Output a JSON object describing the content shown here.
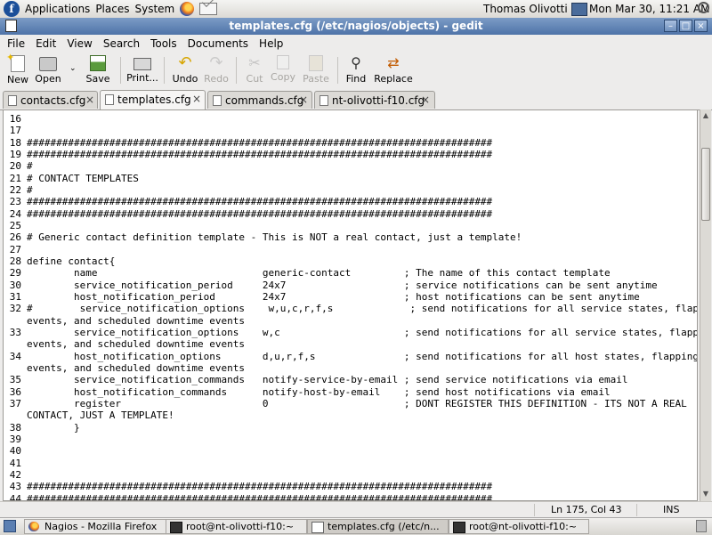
{
  "top_panel": {
    "logo_glyph": "f",
    "menus": [
      "Applications",
      "Places",
      "System"
    ],
    "user": "Thomas Olivotti",
    "clock": "Mon Mar 30, 11:21 AM"
  },
  "window": {
    "title": "templates.cfg (/etc/nagios/objects) - gedit",
    "controls": {
      "minimize": "–",
      "maximize": "□",
      "close": "×"
    }
  },
  "menubar": [
    "File",
    "Edit",
    "View",
    "Search",
    "Tools",
    "Documents",
    "Help"
  ],
  "toolbar": {
    "new": "New",
    "open": "Open",
    "open_dropdown": "⌄",
    "save": "Save",
    "print": "Print...",
    "undo": "Undo",
    "redo": "Redo",
    "cut": "Cut",
    "copy": "Copy",
    "paste": "Paste",
    "find": "Find",
    "replace": "Replace"
  },
  "tabs": [
    {
      "label": "contacts.cfg",
      "active": false
    },
    {
      "label": "templates.cfg",
      "active": true
    },
    {
      "label": "commands.cfg",
      "active": false
    },
    {
      "label": "nt-olivotti-f10.cfg",
      "active": false
    }
  ],
  "tab_close_glyph": "×",
  "editor": {
    "lines": [
      {
        "n": "16",
        "text": ""
      },
      {
        "n": "17",
        "text": ""
      },
      {
        "n": "18",
        "text": "###############################################################################"
      },
      {
        "n": "19",
        "text": "###############################################################################"
      },
      {
        "n": "20",
        "text": "#"
      },
      {
        "n": "21",
        "text": "# CONTACT TEMPLATES"
      },
      {
        "n": "22",
        "text": "#"
      },
      {
        "n": "23",
        "text": "###############################################################################"
      },
      {
        "n": "24",
        "text": "###############################################################################"
      },
      {
        "n": "25",
        "text": ""
      },
      {
        "n": "26",
        "text": "# Generic contact definition template - This is NOT a real contact, just a template!"
      },
      {
        "n": "27",
        "text": ""
      },
      {
        "n": "28",
        "text": "define contact{"
      },
      {
        "n": "29",
        "text": "        name                            generic-contact         ; The name of this contact template"
      },
      {
        "n": "30",
        "text": "        service_notification_period     24x7                    ; service notifications can be sent anytime"
      },
      {
        "n": "31",
        "text": "        host_notification_period        24x7                    ; host notifications can be sent anytime"
      },
      {
        "n": "32",
        "text": "#        service_notification_options    w,u,c,r,f,s             ; send notifications for all service states, flapping"
      },
      {
        "n": "",
        "text": "events, and scheduled downtime events"
      },
      {
        "n": "33",
        "text": "        service_notification_options    w,c                     ; send notifications for all service states, flapping"
      },
      {
        "n": "",
        "text": "events, and scheduled downtime events"
      },
      {
        "n": "34",
        "text": "        host_notification_options       d,u,r,f,s               ; send notifications for all host states, flapping"
      },
      {
        "n": "",
        "text": "events, and scheduled downtime events"
      },
      {
        "n": "35",
        "text": "        service_notification_commands   notify-service-by-email ; send service notifications via email"
      },
      {
        "n": "36",
        "text": "        host_notification_commands      notify-host-by-email    ; send host notifications via email"
      },
      {
        "n": "37",
        "text": "        register                        0                       ; DONT REGISTER THIS DEFINITION - ITS NOT A REAL"
      },
      {
        "n": "",
        "text": "CONTACT, JUST A TEMPLATE!"
      },
      {
        "n": "38",
        "text": "        }"
      },
      {
        "n": "39",
        "text": ""
      },
      {
        "n": "40",
        "text": ""
      },
      {
        "n": "41",
        "text": ""
      },
      {
        "n": "42",
        "text": ""
      },
      {
        "n": "43",
        "text": "###############################################################################"
      },
      {
        "n": "44",
        "text": "###############################################################################"
      }
    ]
  },
  "scrollbar": {
    "up": "▲",
    "down": "▼"
  },
  "statusbar": {
    "position": "Ln 175, Col 43",
    "mode": "INS"
  },
  "taskbar": [
    {
      "label": "Nagios - Mozilla Firefox",
      "active": false
    },
    {
      "label": "root@nt-olivotti-f10:~",
      "active": false
    },
    {
      "label": "templates.cfg (/etc/n...",
      "active": true
    },
    {
      "label": "root@nt-olivotti-f10:~",
      "active": false
    }
  ]
}
